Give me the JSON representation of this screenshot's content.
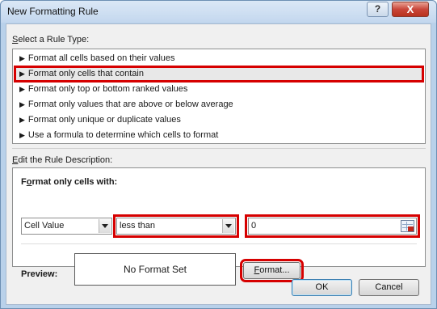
{
  "window": {
    "title": "New Formatting Rule",
    "help_glyph": "?",
    "close_glyph": "X"
  },
  "rule_type": {
    "label_accel": "S",
    "label_rest": "elect a Rule Type:",
    "items": [
      {
        "label": "Format all cells based on their values",
        "selected": false
      },
      {
        "label": "Format only cells that contain",
        "selected": true
      },
      {
        "label": "Format only top or bottom ranked values",
        "selected": false
      },
      {
        "label": "Format only values that are above or below average",
        "selected": false
      },
      {
        "label": "Format only unique or duplicate values",
        "selected": false
      },
      {
        "label": "Use a formula to determine which cells to format",
        "selected": false
      }
    ],
    "arrow_glyph": "▶"
  },
  "description": {
    "label_accel": "E",
    "label_rest": "dit the Rule Description:",
    "heading_pre": "F",
    "heading_accel": "o",
    "heading_post": "rmat only cells with:",
    "cell_value_combo": {
      "value": "Cell Value"
    },
    "operator_combo": {
      "value": "less than"
    },
    "value_input": {
      "value": "0"
    },
    "preview_label": "Preview:",
    "preview_text": "No Format Set",
    "format_button_accel": "F",
    "format_button_rest": "ormat..."
  },
  "buttons": {
    "ok": "OK",
    "cancel": "Cancel"
  },
  "colors": {
    "highlight": "#d60000",
    "title_bar": "#c3d7ee",
    "dialog_bg": "#f0f0f0"
  }
}
